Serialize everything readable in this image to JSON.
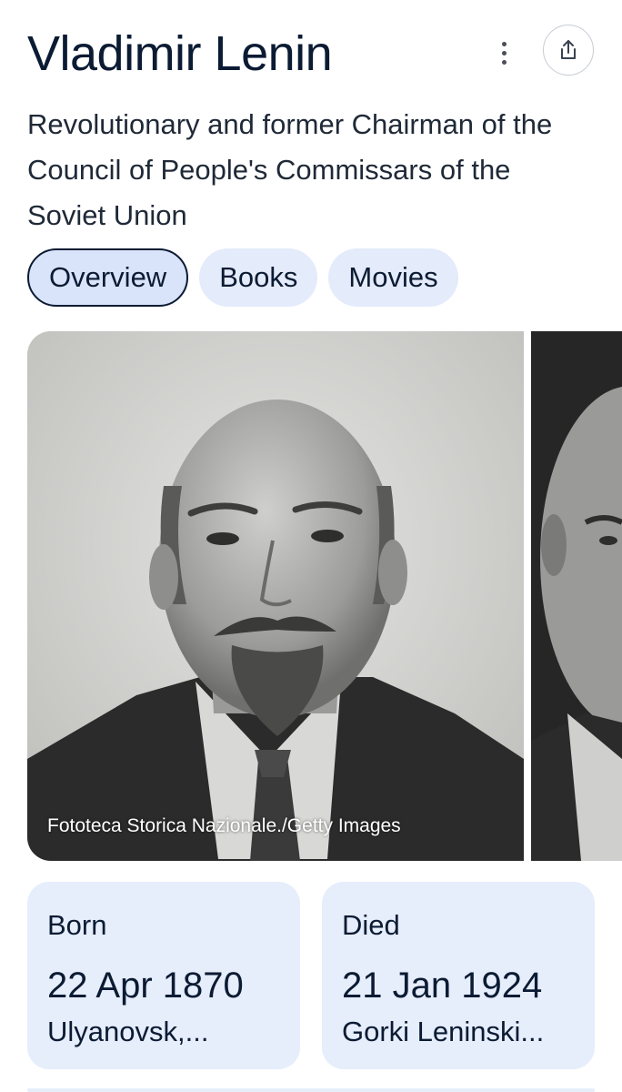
{
  "header": {
    "title": "Vladimir Lenin",
    "subtitle": "Revolutionary and former Chairman of the Council of People's Commissars of the Soviet Union"
  },
  "icons": {
    "menu": "more-vert-icon",
    "share": "share-icon"
  },
  "tabs": [
    {
      "label": "Overview",
      "active": true
    },
    {
      "label": "Books",
      "active": false
    },
    {
      "label": "Movies",
      "active": false
    }
  ],
  "image": {
    "credit": "Fototeca Storica Nazionale./Getty Images"
  },
  "facts": {
    "born": {
      "label": "Born",
      "date": "22 Apr 1870",
      "place": "Ulyanovsk,..."
    },
    "died": {
      "label": "Died",
      "date": "21 Jan 1924",
      "place": "Gorki Leninski..."
    }
  },
  "colors": {
    "chip_bg": "#e4ebfa",
    "card_bg": "#e6edfb",
    "text": "#0b1b33"
  }
}
